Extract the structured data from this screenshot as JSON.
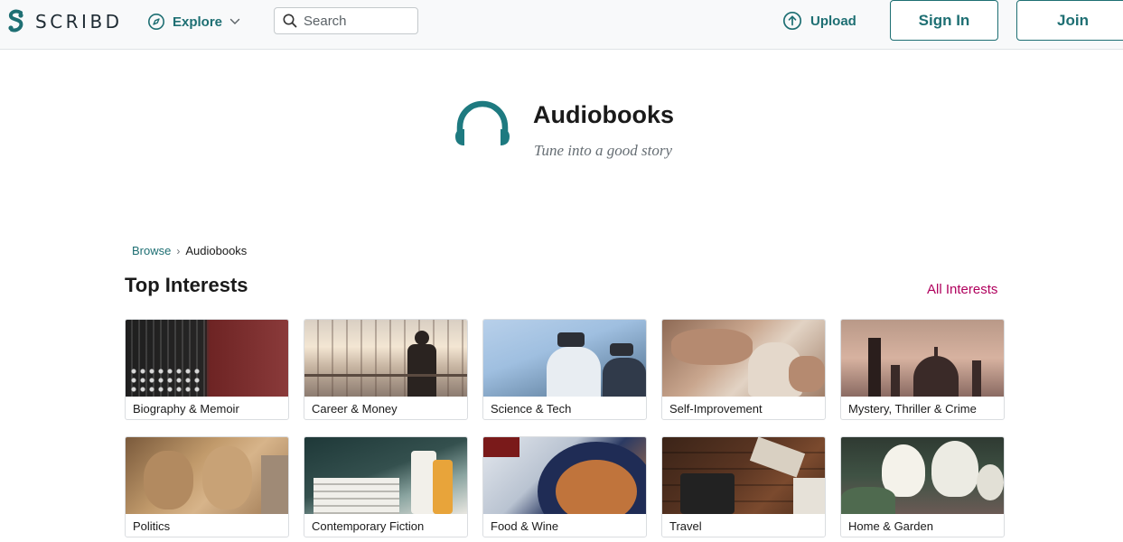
{
  "header": {
    "logo_text": "SCRIBD",
    "explore_label": "Explore",
    "search_placeholder": "Search",
    "upload_label": "Upload",
    "signin_label": "Sign In",
    "join_label": "Join"
  },
  "hero": {
    "title": "Audiobooks",
    "subtitle": "Tune into a good story",
    "icon": "headphones-icon"
  },
  "breadcrumb": {
    "items": [
      "Browse",
      "Audiobooks"
    ],
    "separator": "›"
  },
  "section": {
    "title": "Top Interests",
    "all_link": "All Interests"
  },
  "interests": [
    {
      "label": "Biography & Memoir"
    },
    {
      "label": "Career & Money"
    },
    {
      "label": "Science & Tech"
    },
    {
      "label": "Self-Improvement"
    },
    {
      "label": "Mystery, Thriller & Crime"
    },
    {
      "label": "Politics"
    },
    {
      "label": "Contemporary Fiction"
    },
    {
      "label": "Food & Wine"
    },
    {
      "label": "Travel"
    },
    {
      "label": "Home & Garden"
    }
  ],
  "colors": {
    "brand_teal": "#1e6f73",
    "accent_link": "#b0005d",
    "header_bg": "#f8f9fa"
  }
}
